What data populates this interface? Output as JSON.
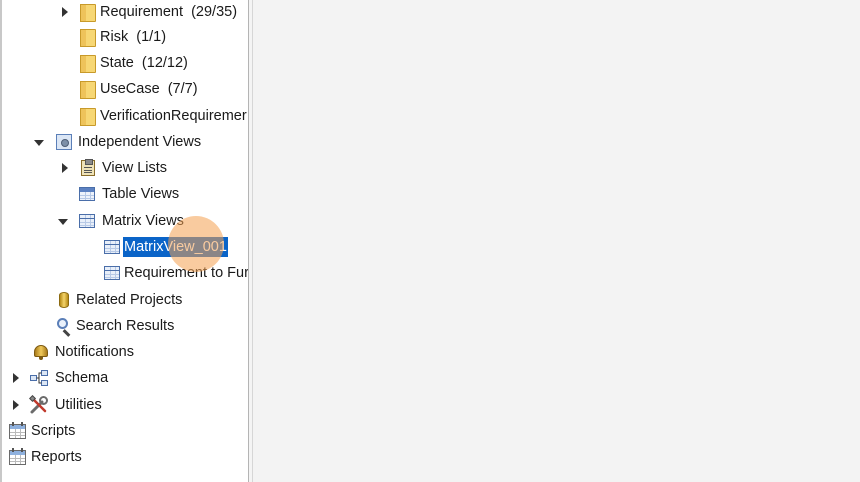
{
  "tree": {
    "items": [
      {
        "label": "Requirement",
        "count": "(29/35)",
        "icon": "folder-icon",
        "expander": "collapsed"
      },
      {
        "label": "Risk",
        "count": "(1/1)",
        "icon": "folder-icon",
        "expander": "none"
      },
      {
        "label": "State",
        "count": "(12/12)",
        "icon": "folder-icon",
        "expander": "none"
      },
      {
        "label": "UseCase",
        "count": "(7/7)",
        "icon": "folder-icon",
        "expander": "none"
      },
      {
        "label": "VerificationRequiremer",
        "count": "",
        "icon": "folder-icon",
        "expander": "none"
      },
      {
        "label": "Independent Views",
        "count": "",
        "icon": "views-icon",
        "expander": "expanded"
      },
      {
        "label": "View Lists",
        "count": "",
        "icon": "clipboard-icon",
        "expander": "collapsed"
      },
      {
        "label": "Table Views",
        "count": "",
        "icon": "table-icon",
        "expander": "none"
      },
      {
        "label": "Matrix Views",
        "count": "",
        "icon": "matrix-icon",
        "expander": "expanded"
      },
      {
        "label": "MatrixView_001",
        "count": "",
        "icon": "matrix-view-icon",
        "expander": "none",
        "selected": true
      },
      {
        "label": "Requirement to Fur",
        "count": "",
        "icon": "matrix-view-icon",
        "expander": "none"
      },
      {
        "label": "Related Projects",
        "count": "",
        "icon": "database-icon",
        "expander": "none"
      },
      {
        "label": "Search Results",
        "count": "",
        "icon": "search-icon",
        "expander": "none"
      },
      {
        "label": "Notifications",
        "count": "",
        "icon": "bell-icon",
        "expander": "none"
      },
      {
        "label": "Schema",
        "count": "",
        "icon": "schema-icon",
        "expander": "collapsed"
      },
      {
        "label": "Utilities",
        "count": "",
        "icon": "tools-icon",
        "expander": "collapsed"
      },
      {
        "label": "Scripts",
        "count": "",
        "icon": "calendar-icon",
        "expander": "none"
      },
      {
        "label": "Reports",
        "count": "",
        "icon": "calendar-icon",
        "expander": "none"
      }
    ]
  },
  "colors": {
    "selection_bg": "#0a64c8",
    "content_bg": "#f3f3f3",
    "click_highlight": "#f4a050"
  }
}
